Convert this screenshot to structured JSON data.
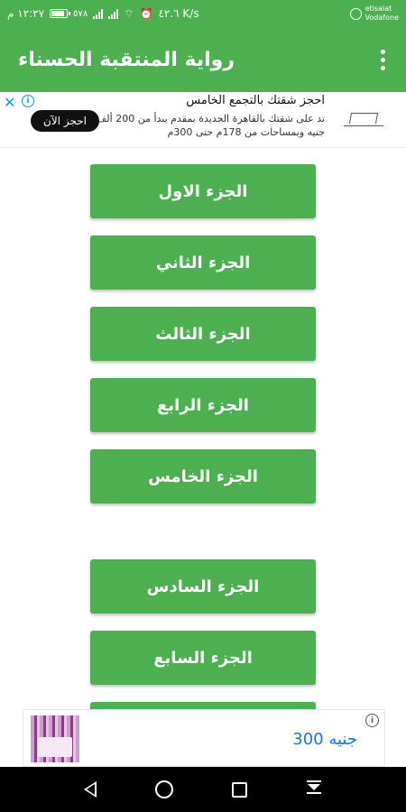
{
  "status_bar": {
    "time": "١٢:٢٧ م",
    "battery": "٥٧٨",
    "network_speed": "٤٢.٦ K/s",
    "carrier_1": "etisalat",
    "carrier_2": "Vodafone",
    "battery_level": 0.78
  },
  "app_bar": {
    "title": "رواية المنتقبة الحسناء"
  },
  "top_ad": {
    "headline": "احجز شقتك بالتجمع الخامس",
    "body": "تد على شقتك بالقاهرة الجديدة بمقدم يبدأ من 200 ألف جنيه وبمساحات من 178م حتى 300م",
    "cta": "احجز الآن",
    "close": "✕",
    "info": "i"
  },
  "parts": [
    {
      "label": "الجزء الاول"
    },
    {
      "label": "الجزء الثاني"
    },
    {
      "label": "الجزء الثالث"
    },
    {
      "label": "الجزء الرابع"
    },
    {
      "label": "الجزء الخامس"
    },
    {
      "label": "الجزء السادس"
    },
    {
      "label": "الجزء السابع"
    },
    {
      "label": ""
    }
  ],
  "bottom_ad": {
    "price": "جنيه 300",
    "info": "i"
  },
  "colors": {
    "primary": "#4caf50",
    "ad_link": "#1a73e8"
  }
}
